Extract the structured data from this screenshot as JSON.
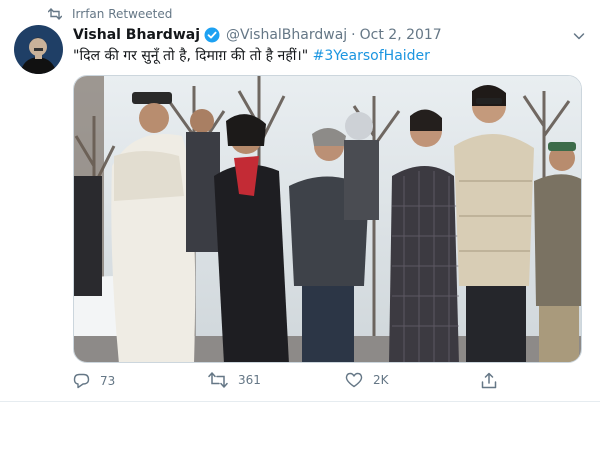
{
  "retweet": {
    "label": "Irrfan Retweeted",
    "icon": "retweet-icon"
  },
  "author": {
    "name": "Vishal Bhardwaj",
    "handle": "@VishalBhardwaj",
    "separator": "·",
    "date": "Oct 2, 2017",
    "verified": true
  },
  "tweet": {
    "text": "\"दिल की गर सुनूँ तो है, दिमाग़ की तो है नहीं।\" ",
    "hashtag": "#3YearsofHaider"
  },
  "actions": {
    "reply": {
      "count": "73",
      "icon": "reply-icon"
    },
    "retweet": {
      "count": "361",
      "icon": "retweet-icon"
    },
    "like": {
      "count": "2K",
      "icon": "heart-icon"
    },
    "share": {
      "icon": "share-icon"
    }
  },
  "colors": {
    "accent": "#1b95e0",
    "muted": "#657786",
    "text": "#14171a",
    "verified": "#1da1f2"
  }
}
